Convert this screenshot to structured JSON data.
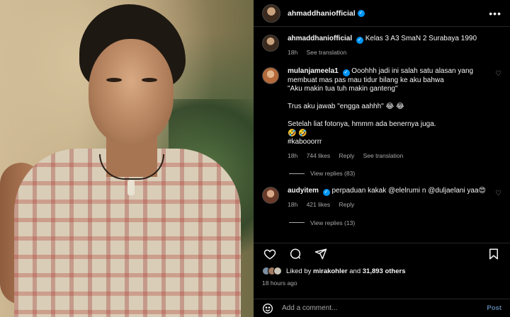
{
  "post": {
    "author": "ahmaddhaniofficial",
    "verified": true
  },
  "caption": {
    "username": "ahmaddhaniofficial",
    "text": "Kelas 3 A3 SmaN 2 Surabaya 1990",
    "time": "18h",
    "translate": "See translation"
  },
  "comments": [
    {
      "username": "mulanjameela1",
      "lines": [
        "Ooohhh jadi ini salah satu alasan yang",
        "membuat mas pas mau tidur bilang ke aku bahwa",
        "\"Aku makin tua tuh makin ganteng\"",
        "",
        "Trus aku jawab \"engga aahhh\" 😂 😂",
        "",
        "Setelah liat fotonya, hmmm ada benernya juga.",
        "🤣 🤣",
        "#kabooorrr"
      ],
      "time": "18h",
      "likes": "744 likes",
      "reply": "Reply",
      "translate": "See translation",
      "view_replies": "View replies (83)"
    },
    {
      "username": "audyitem",
      "lines": [
        "perpaduan kakak @elelrumi n @duljaelani yaa😍"
      ],
      "time": "18h",
      "likes": "421 likes",
      "reply": "Reply",
      "view_replies": "View replies (13)"
    }
  ],
  "actions": {
    "icons": [
      "heart-icon",
      "comment-icon",
      "share-icon",
      "bookmark-icon"
    ]
  },
  "likes_summary": {
    "prefix": "Liked by ",
    "user": "mirakohler",
    "middle": " and ",
    "count": "31,893 others"
  },
  "timestamp": "18 hours ago",
  "add_comment": {
    "placeholder": "Add a comment...",
    "post_label": "Post"
  },
  "colors": {
    "background": "#000000",
    "text": "#f5f5f5",
    "secondary": "#a8a8a8",
    "verified": "#0095f6",
    "post_disabled": "#5a7fa6"
  }
}
